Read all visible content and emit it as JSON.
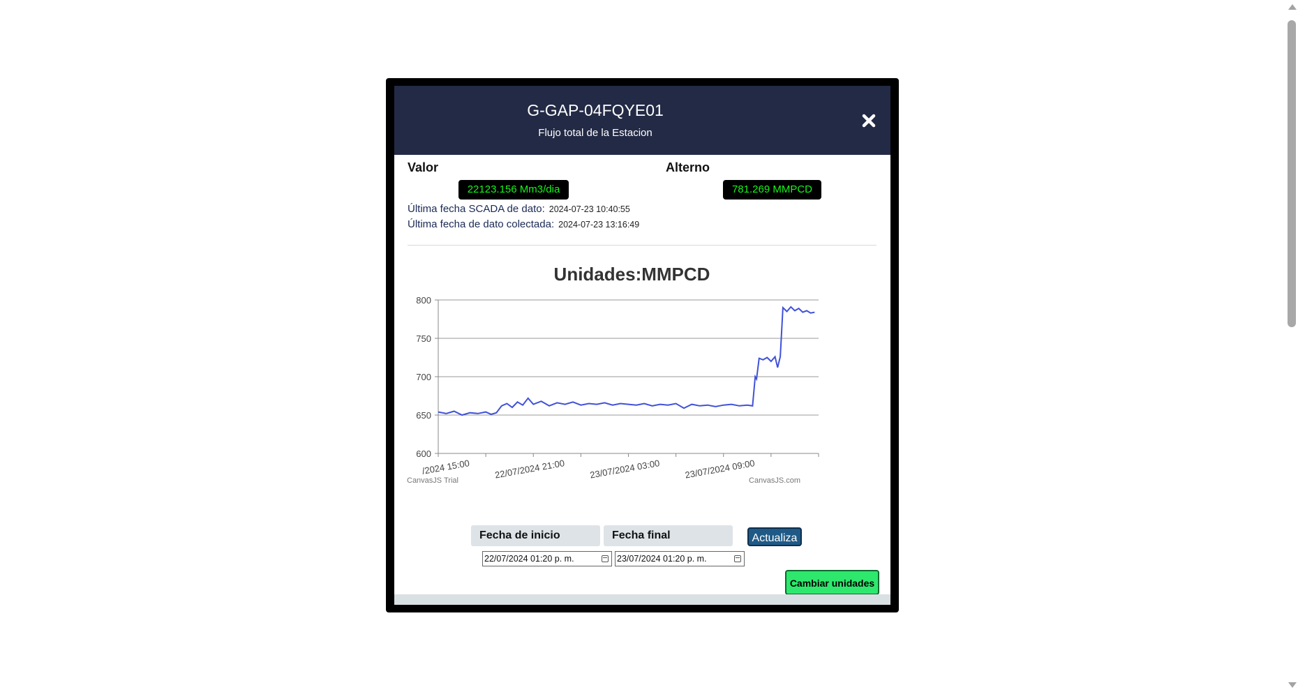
{
  "modal": {
    "title": "G-GAP-04FQYE01",
    "subtitle": "Flujo total de la Estacion",
    "close_icon": "close-icon"
  },
  "values": {
    "valor_label": "Valor",
    "valor": "22123.156 Mm3/dia",
    "alterno_label": "Alterno",
    "alterno": "781.269 MMPCD",
    "scada_label": "Última fecha SCADA de dato:",
    "scada_date": "2024-07-23 10:40:55",
    "colectada_label": "Última fecha de dato colectada:",
    "colectada_date": "2024-07-23 13:16:49",
    "badge_text_color": "#16f51a"
  },
  "chart_data": {
    "type": "line",
    "title": "Unidades:MMPCD",
    "xlabel": "",
    "ylabel": "",
    "ylim": [
      600,
      800
    ],
    "yticks": [
      600,
      650,
      700,
      750,
      800
    ],
    "xlim": [
      "2024-07-22 13:00",
      "2024-07-23 13:00"
    ],
    "xtick_labels": [
      "/2024 15:00",
      "22/07/2024 21:00",
      "23/07/2024 03:00",
      "23/07/2024 09:00"
    ],
    "xtick_times": [
      "2024-07-22 15:00",
      "2024-07-22 21:00",
      "2024-07-23 03:00",
      "2024-07-23 09:00"
    ],
    "grid": true,
    "line_color": "#3f51d9",
    "series": [
      {
        "x": [
          "2024-07-22 13:00",
          "2024-07-22 13:30",
          "2024-07-22 14:00",
          "2024-07-22 14:30",
          "2024-07-22 15:00",
          "2024-07-22 15:30",
          "2024-07-22 16:00",
          "2024-07-22 16:20",
          "2024-07-22 16:40",
          "2024-07-22 17:00",
          "2024-07-22 17:20",
          "2024-07-22 17:40",
          "2024-07-22 18:00",
          "2024-07-22 18:20",
          "2024-07-22 18:40",
          "2024-07-22 19:00",
          "2024-07-22 19:30",
          "2024-07-22 20:00",
          "2024-07-22 20:30",
          "2024-07-22 21:00",
          "2024-07-22 21:30",
          "2024-07-22 22:00",
          "2024-07-22 22:30",
          "2024-07-22 23:00",
          "2024-07-22 23:30",
          "2024-07-23 00:00",
          "2024-07-23 00:30",
          "2024-07-23 01:00",
          "2024-07-23 01:30",
          "2024-07-23 02:00",
          "2024-07-23 02:30",
          "2024-07-23 03:00",
          "2024-07-23 03:30",
          "2024-07-23 04:00",
          "2024-07-23 04:30",
          "2024-07-23 05:00",
          "2024-07-23 05:30",
          "2024-07-23 06:00",
          "2024-07-23 06:30",
          "2024-07-23 07:00",
          "2024-07-23 07:30",
          "2024-07-23 08:00",
          "2024-07-23 08:30",
          "2024-07-23 08:50",
          "2024-07-23 09:00",
          "2024-07-23 09:05",
          "2024-07-23 09:15",
          "2024-07-23 09:30",
          "2024-07-23 09:45",
          "2024-07-23 10:00",
          "2024-07-23 10:15",
          "2024-07-23 10:25",
          "2024-07-23 10:35",
          "2024-07-23 10:45",
          "2024-07-23 11:00",
          "2024-07-23 11:15",
          "2024-07-23 11:30",
          "2024-07-23 11:45",
          "2024-07-23 12:00",
          "2024-07-23 12:15",
          "2024-07-23 12:30",
          "2024-07-23 12:45"
        ],
        "y": [
          654,
          652,
          655,
          650,
          653,
          652,
          654,
          651,
          653,
          662,
          665,
          660,
          667,
          663,
          672,
          664,
          668,
          662,
          666,
          664,
          667,
          663,
          665,
          664,
          666,
          663,
          665,
          664,
          663,
          665,
          662,
          664,
          663,
          665,
          659,
          664,
          662,
          663,
          661,
          663,
          664,
          662,
          663,
          662,
          700,
          697,
          724,
          722,
          725,
          720,
          726,
          712,
          726,
          790,
          785,
          791,
          786,
          789,
          784,
          786,
          783,
          784
        ]
      }
    ],
    "watermark_left": "CanvasJS Trial",
    "watermark_right": "CanvasJS.com"
  },
  "controls": {
    "start_label": "Fecha de inicio",
    "end_label": "Fecha final",
    "update_button": "Actualiza",
    "start_value": "22/07/2024 01:20  p. m.",
    "end_value": "23/07/2024 01:20  p. m.",
    "change_units_button": "Cambiar unidades"
  }
}
